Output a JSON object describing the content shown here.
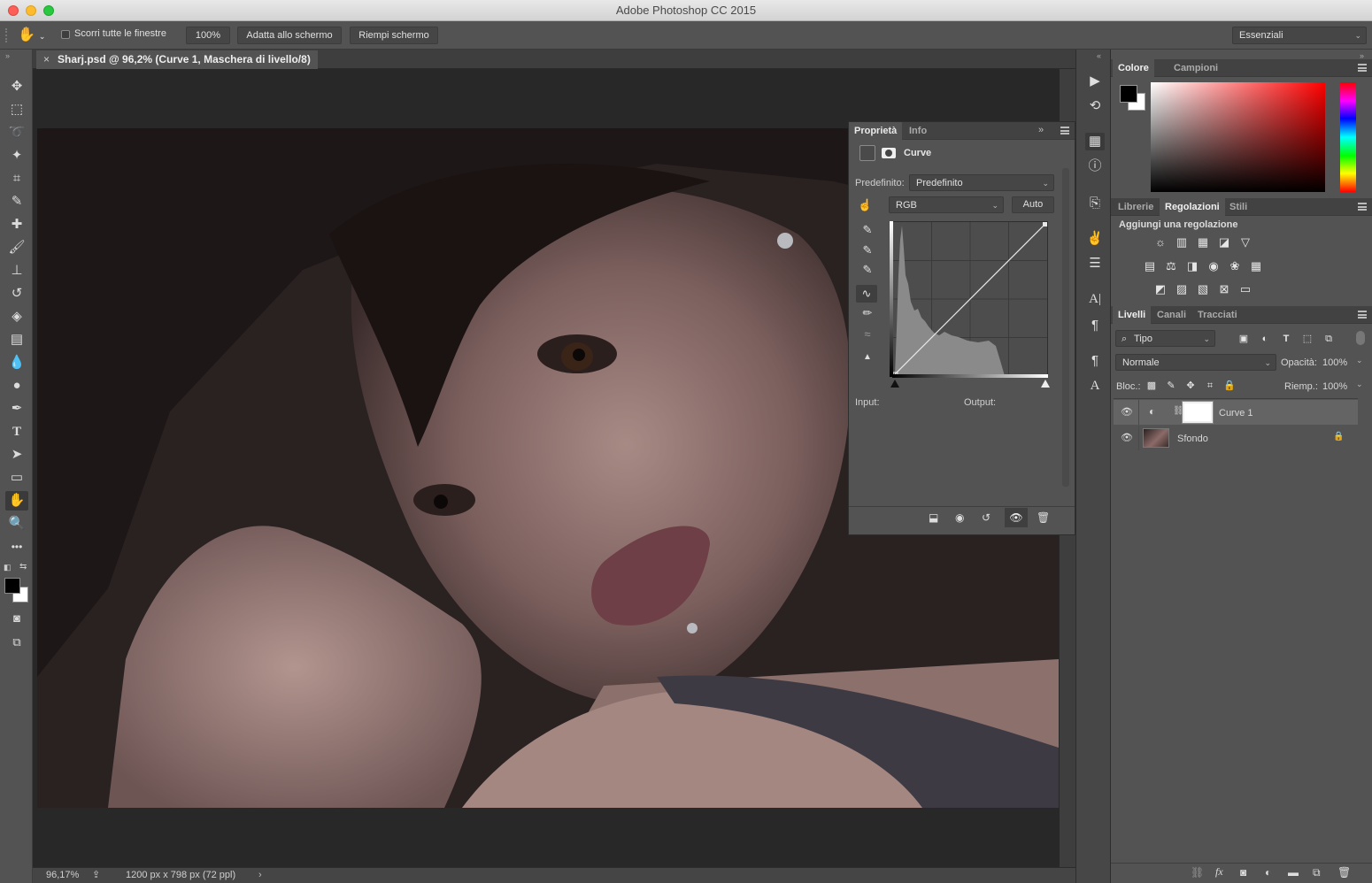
{
  "app": {
    "window_title": "Adobe Photoshop CC 2015"
  },
  "options_bar": {
    "scroll_all_label": "Scorri tutte le finestre",
    "zoom_btn": "100%",
    "fit_screen_btn": "Adatta allo schermo",
    "fill_screen_btn": "Riempi schermo",
    "workspace": "Essenziali"
  },
  "document": {
    "tab_title": "Sharj.psd @ 96,2% (Curve 1, Maschera di livello/8)",
    "zoom": "96,17%",
    "info": "1200 px x 798 px (72 ppl)"
  },
  "properties": {
    "tabs": [
      "Proprietà",
      "Info"
    ],
    "panel_title": "Curve",
    "preset_label": "Predefinito:",
    "preset_value": "Predefinito",
    "channel_value": "RGB",
    "auto_btn": "Auto",
    "input_label": "Input:",
    "output_label": "Output:"
  },
  "color_panel": {
    "tabs": [
      "Colore",
      "Campioni"
    ]
  },
  "adjust_panel": {
    "tabs": [
      "Librerie",
      "Regolazioni",
      "Stili"
    ],
    "heading": "Aggiungi una regolazione"
  },
  "layers_panel": {
    "tabs": [
      "Livelli",
      "Canali",
      "Tracciati"
    ],
    "filter_kind": "Tipo",
    "blend_mode": "Normale",
    "opacity_label": "Opacità:",
    "opacity_value": "100%",
    "lock_label": "Bloc.:",
    "fill_label": "Riemp.:",
    "fill_value": "100%",
    "layers": [
      {
        "name": "Curve 1"
      },
      {
        "name": "Sfondo"
      }
    ]
  },
  "colors": {
    "ui_bg": "#535353",
    "canvas_bg": "#282828",
    "selected_layer": "#646464"
  }
}
